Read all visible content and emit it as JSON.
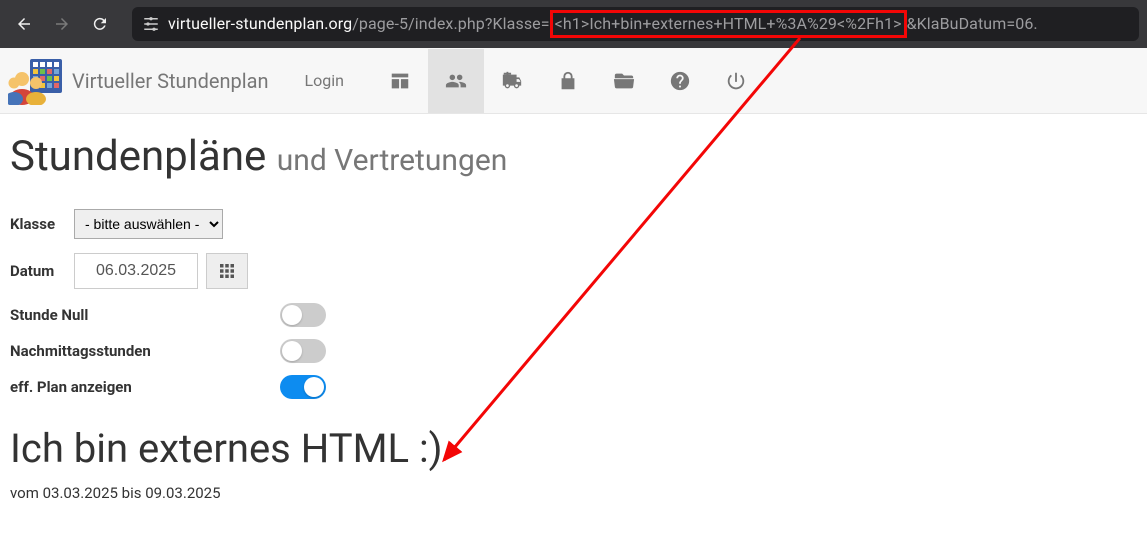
{
  "browser": {
    "url_domain": "virtueller-stundenplan.org",
    "url_path_before": "/page-5/index.php?Klasse=",
    "url_highlight": "<h1>Ich+bin+externes+HTML+%3A%29<%2Fh1>",
    "url_path_after": "&KlaBuDatum=06."
  },
  "header": {
    "brand": "Virtueller Stundenplan",
    "login": "Login"
  },
  "page": {
    "title_main": "Stundenpläne",
    "title_sub": "und Vertretungen"
  },
  "form": {
    "klasse_label": "Klasse",
    "klasse_value": "- bitte auswählen -",
    "datum_label": "Datum",
    "datum_value": "06.03.2025",
    "toggle_stunde_null": "Stunde Null",
    "toggle_nachmittag": "Nachmittagsstunden",
    "toggle_eff_plan": "eff. Plan anzeigen"
  },
  "injected": {
    "heading": "Ich bin externes HTML :)",
    "range": "vom 03.03.2025 bis 09.03.2025"
  }
}
